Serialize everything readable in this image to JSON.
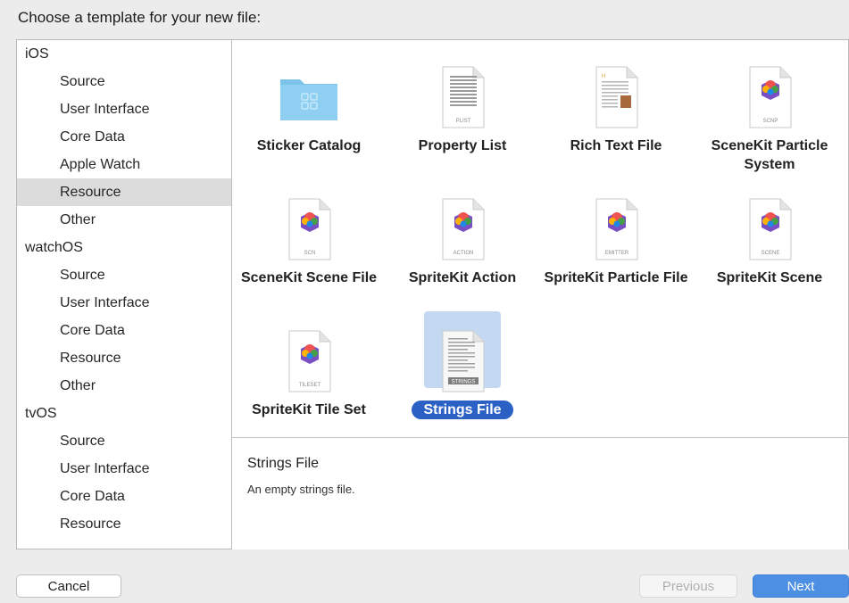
{
  "header": {
    "title": "Choose a template for your new file:"
  },
  "sidebar": {
    "rows": [
      {
        "type": "section",
        "label": "iOS"
      },
      {
        "type": "item",
        "label": "Source"
      },
      {
        "type": "item",
        "label": "User Interface"
      },
      {
        "type": "item",
        "label": "Core Data"
      },
      {
        "type": "item",
        "label": "Apple Watch"
      },
      {
        "type": "item",
        "label": "Resource",
        "selected": true
      },
      {
        "type": "item",
        "label": "Other"
      },
      {
        "type": "section",
        "label": "watchOS"
      },
      {
        "type": "item",
        "label": "Source"
      },
      {
        "type": "item",
        "label": "User Interface"
      },
      {
        "type": "item",
        "label": "Core Data"
      },
      {
        "type": "item",
        "label": "Resource"
      },
      {
        "type": "item",
        "label": "Other"
      },
      {
        "type": "section",
        "label": "tvOS"
      },
      {
        "type": "item",
        "label": "Source"
      },
      {
        "type": "item",
        "label": "User Interface"
      },
      {
        "type": "item",
        "label": "Core Data"
      },
      {
        "type": "item",
        "label": "Resource"
      }
    ]
  },
  "templates": [
    {
      "label": "Sticker Catalog",
      "icon": "folder-icon"
    },
    {
      "label": "Property List",
      "icon": "plist-icon",
      "tag": "PLIST"
    },
    {
      "label": "Rich Text File",
      "icon": "rich-text-icon"
    },
    {
      "label": "SceneKit Particle System",
      "icon": "scnp-icon",
      "tag": "SCNP"
    },
    {
      "label": "SceneKit Scene File",
      "icon": "scn-icon",
      "tag": "SCN"
    },
    {
      "label": "SpriteKit Action",
      "icon": "action-icon",
      "tag": "ACTION"
    },
    {
      "label": "SpriteKit Particle File",
      "icon": "emitter-icon",
      "tag": "EMITTER"
    },
    {
      "label": "SpriteKit Scene",
      "icon": "scene-icon",
      "tag": "SCENE"
    },
    {
      "label": "SpriteKit Tile Set",
      "icon": "tileset-icon",
      "tag": "TILESET"
    },
    {
      "label": "Strings File",
      "icon": "strings-icon",
      "tag": "STRINGS",
      "selected": true
    }
  ],
  "description": {
    "title": "Strings File",
    "text": "An empty strings file."
  },
  "buttons": {
    "cancel": "Cancel",
    "previous": "Previous",
    "next": "Next"
  },
  "colors": {
    "accent": "#2b61c4",
    "next_button": "#4c8fe3",
    "selection_bg": "#c5d8f2"
  }
}
